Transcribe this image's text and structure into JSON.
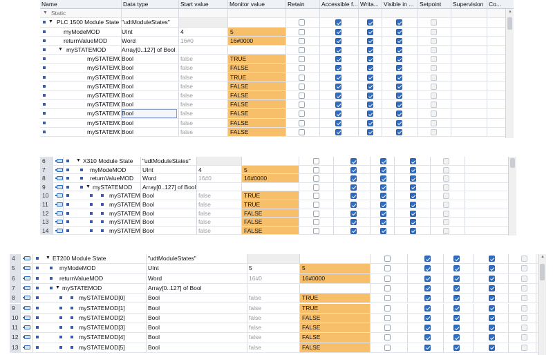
{
  "panel1": {
    "headers": {
      "name": "Name",
      "type": "Data type",
      "start": "Start value",
      "monitor": "Monitor value",
      "retain": "Retain",
      "access": "Accessible f...",
      "write": "Writa...",
      "visible": "Visible in ...",
      "setpoint": "Setpoint",
      "supervision": "Supervision",
      "co": "Co..."
    },
    "rows": [
      {
        "name": "Static",
        "type": "",
        "start": "",
        "monitor": "",
        "kind": "section"
      },
      {
        "name": "PLC 1500 Module State",
        "type": "\"udtModuleStates\"",
        "start": "",
        "monitor": "",
        "kind": "struct",
        "retain": false,
        "access": true,
        "write": true,
        "visible": true
      },
      {
        "name": "myModeMOD",
        "type": "UInt",
        "start": "4",
        "monitor": "5",
        "kind": "leaf",
        "retain": false,
        "access": true,
        "write": true,
        "visible": true
      },
      {
        "name": "returnValueMOD",
        "type": "Word",
        "start": "16#0",
        "monitor": "16#0000",
        "kind": "leaf",
        "startGrey": true,
        "retain": false,
        "access": true,
        "write": true,
        "visible": true
      },
      {
        "name": "mySTATEMOD",
        "type": "Array[0..127] of Bool",
        "start": "",
        "monitor": "",
        "kind": "array",
        "retain": false,
        "access": true,
        "write": true,
        "visible": true
      },
      {
        "name": "mySTATEMOD[...",
        "type": "Bool",
        "start": "false",
        "monitor": "TRUE",
        "kind": "elem",
        "retain": false,
        "access": true,
        "write": true,
        "visible": true
      },
      {
        "name": "mySTATEMOD[...",
        "type": "Bool",
        "start": "false",
        "monitor": "FALSE",
        "kind": "elem",
        "retain": false,
        "access": true,
        "write": true,
        "visible": true
      },
      {
        "name": "mySTATEMOD[...",
        "type": "Bool",
        "start": "false",
        "monitor": "TRUE",
        "kind": "elem",
        "retain": false,
        "access": true,
        "write": true,
        "visible": true
      },
      {
        "name": "mySTATEMOD[...",
        "type": "Bool",
        "start": "false",
        "monitor": "FALSE",
        "kind": "elem",
        "retain": false,
        "access": true,
        "write": true,
        "visible": true
      },
      {
        "name": "mySTATEMOD[...",
        "type": "Bool",
        "start": "false",
        "monitor": "FALSE",
        "kind": "elem",
        "retain": false,
        "access": true,
        "write": true,
        "visible": true
      },
      {
        "name": "mySTATEMOD[...",
        "type": "Bool",
        "start": "false",
        "monitor": "FALSE",
        "kind": "elem",
        "retain": false,
        "access": true,
        "write": true,
        "visible": true
      },
      {
        "name": "mySTATEMOD[...",
        "type": "Bool",
        "start": "false",
        "monitor": "FALSE",
        "kind": "elem",
        "selected": true,
        "retain": false,
        "access": true,
        "write": true,
        "visible": true
      },
      {
        "name": "mySTATEMOD[...",
        "type": "Bool",
        "start": "false",
        "monitor": "FALSE",
        "kind": "elem",
        "retain": false,
        "access": true,
        "write": true,
        "visible": true
      },
      {
        "name": "mySTATEMOD[...",
        "type": "Bool",
        "start": "false",
        "monitor": "FALSE",
        "kind": "elem",
        "retain": false,
        "access": true,
        "write": true,
        "visible": true
      }
    ]
  },
  "panel2": {
    "rows": [
      {
        "num": "6",
        "name": "X310 Module State",
        "type": "\"udtModuleStates\"",
        "start": "",
        "monitor": "",
        "kind": "struct",
        "retain": false,
        "access": true,
        "write": true,
        "visible": true
      },
      {
        "num": "7",
        "name": "myModeMOD",
        "type": "UInt",
        "start": "4",
        "monitor": "5",
        "kind": "leaf",
        "retain": false,
        "access": true,
        "write": true,
        "visible": true
      },
      {
        "num": "8",
        "name": "returnValueMOD",
        "type": "Word",
        "start": "16#0",
        "monitor": "16#0000",
        "kind": "leaf",
        "startGrey": true,
        "retain": false,
        "access": true,
        "write": true,
        "visible": true
      },
      {
        "num": "9",
        "name": "mySTATEMOD",
        "type": "Array[0..127] of Bool",
        "start": "",
        "monitor": "",
        "kind": "array",
        "retain": false,
        "access": true,
        "write": true,
        "visible": true
      },
      {
        "num": "10",
        "name": "mySTATEMOD[...",
        "type": "Bool",
        "start": "false",
        "monitor": "TRUE",
        "kind": "elem",
        "retain": false,
        "access": true,
        "write": true,
        "visible": true
      },
      {
        "num": "11",
        "name": "mySTATEMOD[...",
        "type": "Bool",
        "start": "false",
        "monitor": "TRUE",
        "kind": "elem",
        "retain": false,
        "access": true,
        "write": true,
        "visible": true
      },
      {
        "num": "12",
        "name": "mySTATEMOD[...",
        "type": "Bool",
        "start": "false",
        "monitor": "FALSE",
        "kind": "elem",
        "retain": false,
        "access": true,
        "write": true,
        "visible": true
      },
      {
        "num": "13",
        "name": "mySTATEMOD[...",
        "type": "Bool",
        "start": "false",
        "monitor": "FALSE",
        "kind": "elem",
        "retain": false,
        "access": true,
        "write": true,
        "visible": true
      },
      {
        "num": "14",
        "name": "mySTATEMOD[...",
        "type": "Bool",
        "start": "false",
        "monitor": "FALSE",
        "kind": "elem",
        "retain": false,
        "access": true,
        "write": true,
        "visible": true
      }
    ]
  },
  "panel3": {
    "rows": [
      {
        "num": "4",
        "name": "ET200 Module State",
        "type": "\"udtModuleStates\"",
        "start": "",
        "monitor": "",
        "kind": "struct",
        "retain": false,
        "access": true,
        "write": true,
        "visible": true
      },
      {
        "num": "5",
        "name": "myModeMOD",
        "type": "UInt",
        "start": "5",
        "monitor": "5",
        "kind": "leaf",
        "retain": false,
        "access": true,
        "write": true,
        "visible": true
      },
      {
        "num": "6",
        "name": "returnValueMOD",
        "type": "Word",
        "start": "16#0",
        "monitor": "16#0000",
        "kind": "leaf",
        "startGrey": true,
        "retain": false,
        "access": true,
        "write": true,
        "visible": true
      },
      {
        "num": "7",
        "name": "mySTATEMOD",
        "type": "Array[0..127] of Bool",
        "start": "",
        "monitor": "",
        "kind": "array",
        "retain": false,
        "access": true,
        "write": true,
        "visible": true
      },
      {
        "num": "8",
        "name": "mySTATEMOD[0]",
        "type": "Bool",
        "start": "false",
        "monitor": "TRUE",
        "kind": "elem",
        "retain": false,
        "access": true,
        "write": true,
        "visible": true
      },
      {
        "num": "9",
        "name": "mySTATEMOD[1]",
        "type": "Bool",
        "start": "false",
        "monitor": "TRUE",
        "kind": "elem",
        "retain": false,
        "access": true,
        "write": true,
        "visible": true
      },
      {
        "num": "10",
        "name": "mySTATEMOD[2]",
        "type": "Bool",
        "start": "false",
        "monitor": "FALSE",
        "kind": "elem",
        "retain": false,
        "access": true,
        "write": true,
        "visible": true
      },
      {
        "num": "11",
        "name": "mySTATEMOD[3]",
        "type": "Bool",
        "start": "false",
        "monitor": "FALSE",
        "kind": "elem",
        "retain": false,
        "access": true,
        "write": true,
        "visible": true
      },
      {
        "num": "12",
        "name": "mySTATEMOD[4]",
        "type": "Bool",
        "start": "false",
        "monitor": "FALSE",
        "kind": "elem",
        "retain": false,
        "access": true,
        "write": true,
        "visible": true
      },
      {
        "num": "13",
        "name": "mySTATEMOD[5]",
        "type": "Bool",
        "start": "false",
        "monitor": "FALSE",
        "kind": "elem",
        "retain": false,
        "access": true,
        "write": true,
        "visible": true
      }
    ]
  },
  "colors": {
    "monitor": "#f8bf6b",
    "checkbox_on": "#2f6cc2",
    "bullet": "#3a5ca8",
    "header_bg": "#eef1f5"
  }
}
